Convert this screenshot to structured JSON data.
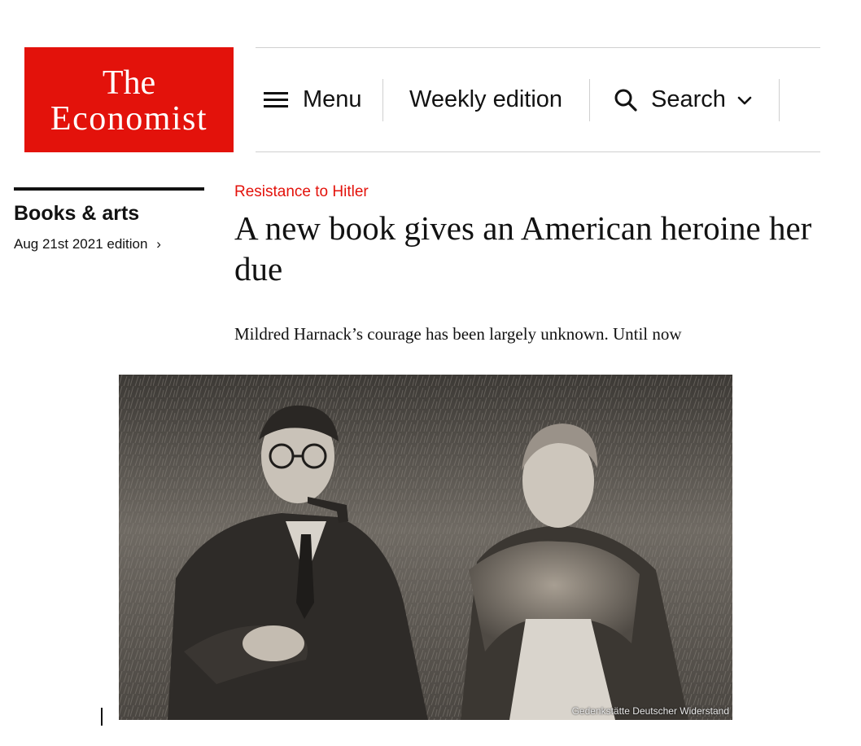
{
  "brand": {
    "logo_line1": "The",
    "logo_line2": "Economist",
    "color": "#e3120b"
  },
  "nav": {
    "menu_label": "Menu",
    "menu_icon": "hamburger-icon",
    "weekly_label": "Weekly edition",
    "search_label": "Search",
    "search_icon": "search-icon",
    "search_chevron_icon": "chevron-down-icon"
  },
  "section": {
    "name": "Books & arts",
    "edition": "Aug 21st 2021 edition",
    "edition_chevron": "›"
  },
  "article": {
    "rubric": "Resistance to Hitler",
    "headline": "A new book gives an American heroine her due",
    "subheadline": "Mildred Harnack’s courage has been largely unknown. Until now",
    "image_credit": "Gedenkstätte Deutscher Widerstand"
  }
}
